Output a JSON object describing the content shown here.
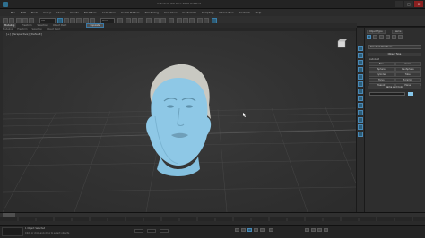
{
  "window": {
    "title": "Autodesk 3ds Max 2019   Untitled"
  },
  "toolbar": {
    "selection_filter": "All",
    "reference_system": "View"
  },
  "menus": [
    "File",
    "Edit",
    "Tools",
    "Group",
    "Views",
    "Create",
    "Modifiers",
    "Animation",
    "Graph Editors",
    "Rendering",
    "Civil View",
    "Customize",
    "Scripting",
    "Interactive",
    "Content",
    "Help"
  ],
  "ribbon": {
    "tabs": [
      "Modeling",
      "Freeform",
      "Selection",
      "Object Paint",
      "Populate"
    ],
    "active_button": "Populate"
  },
  "viewport": {
    "label": "[+] [Perspective] [Default]"
  },
  "command_panel": {
    "tabs": [
      "Object Type",
      "Name"
    ],
    "dropdown": "Standard Primitives",
    "rollout_object_type": "Object Type",
    "autogrid": "AutoGrid",
    "buttons": [
      "Box",
      "Cone",
      "Sphere",
      "GeoSphere",
      "Cylinder",
      "Tube",
      "Torus",
      "Pyramid",
      "Teapot",
      "Plane"
    ],
    "rollout_name_color": "Name and Color",
    "colors": {
      "object_color": "#86c6ea",
      "accent": "#3a7ea8"
    }
  },
  "status": {
    "selection": "1 Object Selected",
    "prompt": "Click or click-and-drag to select objects"
  },
  "timeline": {
    "frame": "0 / 100"
  }
}
